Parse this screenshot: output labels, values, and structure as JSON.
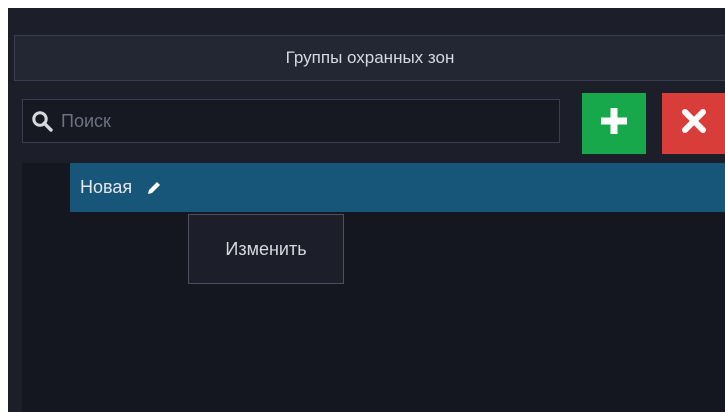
{
  "header": {
    "title": "Группы охранных зон"
  },
  "search": {
    "value": "",
    "placeholder": "Поиск",
    "icon": "search-icon"
  },
  "toolbar": {
    "add_icon": "plus-icon",
    "delete_icon": "close-icon",
    "add_color": "#18a84c",
    "delete_color": "#d93d39"
  },
  "list": {
    "items": [
      {
        "label": "Новая",
        "selected": true,
        "icon": "pencil-icon"
      }
    ]
  },
  "context_menu": {
    "items": [
      {
        "label": "Изменить"
      }
    ]
  },
  "colors": {
    "background": "#1c1e29",
    "selected": "#185679"
  }
}
